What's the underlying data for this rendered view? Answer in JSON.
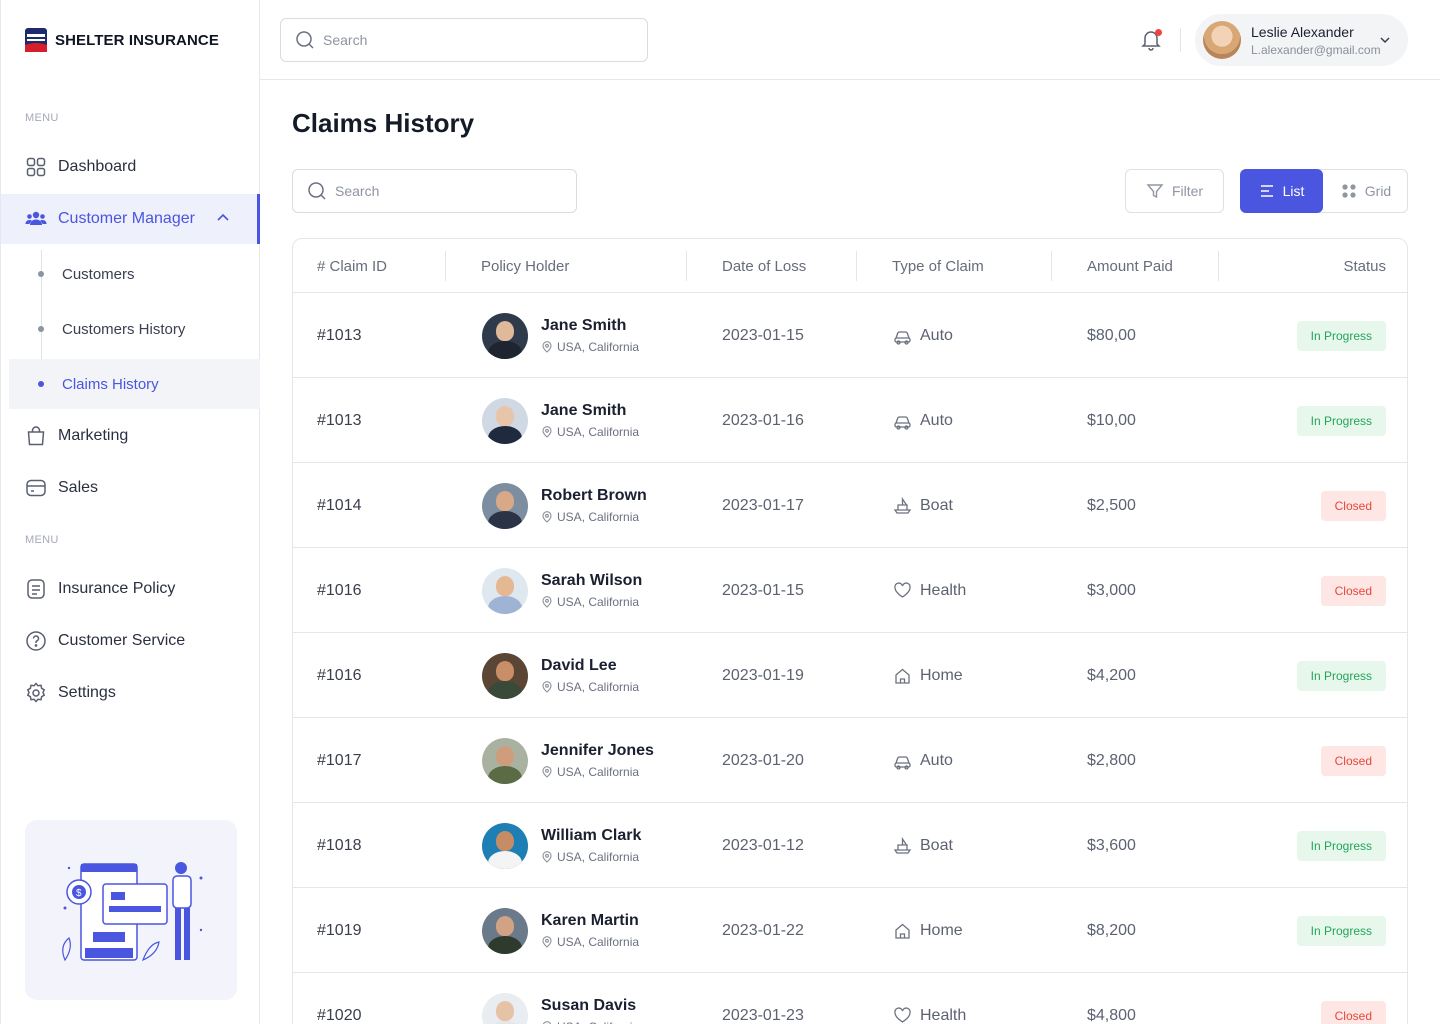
{
  "brand": {
    "name": "SHELTER INSURANCE"
  },
  "sidebar": {
    "menu_caption_1": "MENU",
    "menu_caption_2": "MENU",
    "items": [
      {
        "label": "Dashboard",
        "icon": "grid-icon"
      },
      {
        "label": "Customer Manager",
        "icon": "users-icon",
        "active": true,
        "expanded": true
      },
      {
        "label": "Marketing",
        "icon": "bag-icon"
      },
      {
        "label": "Sales",
        "icon": "card-icon"
      }
    ],
    "sub_items": [
      {
        "label": "Customers"
      },
      {
        "label": "Customers History"
      },
      {
        "label": "Claims History",
        "active": true
      }
    ],
    "items_2": [
      {
        "label": "Insurance Policy",
        "icon": "document-icon"
      },
      {
        "label": "Customer Service",
        "icon": "help-icon"
      },
      {
        "label": "Settings",
        "icon": "gear-icon"
      }
    ]
  },
  "topbar": {
    "search_placeholder": "Search",
    "user": {
      "name": "Leslie Alexander",
      "email": "L.alexander@gmail.com"
    }
  },
  "main": {
    "title": "Claims History",
    "search_placeholder": "Search",
    "filter_label": "Filter",
    "list_label": "List",
    "grid_label": "Grid"
  },
  "colors": {
    "accent": "#4a55e0",
    "in_progress_bg": "#e8f7ec",
    "in_progress_text": "#22a559",
    "closed_bg": "#fde6e4",
    "closed_text": "#e5483c"
  },
  "table": {
    "columns": [
      "# Claim ID",
      "Policy Holder",
      "Date of Loss",
      "Type of Claim",
      "Amount Paid",
      "Status"
    ],
    "rows": [
      {
        "id": "#1013",
        "name": "Jane Smith",
        "location": "USA, California",
        "date": "2023-01-15",
        "type": "Auto",
        "type_icon": "car-icon",
        "amount": "$80,00",
        "status": "In Progress",
        "status_kind": "progress"
      },
      {
        "id": "#1013",
        "name": "Jane Smith",
        "location": "USA, California",
        "date": "2023-01-16",
        "type": "Auto",
        "type_icon": "car-icon",
        "amount": "$10,00",
        "status": "In Progress",
        "status_kind": "progress"
      },
      {
        "id": "#1014",
        "name": "Robert Brown",
        "location": "USA, California",
        "date": "2023-01-17",
        "type": "Boat",
        "type_icon": "boat-icon",
        "amount": "$2,500",
        "status": "Closed",
        "status_kind": "closed"
      },
      {
        "id": "#1016",
        "name": "Sarah Wilson",
        "location": "USA, California",
        "date": "2023-01-15",
        "type": "Health",
        "type_icon": "heart-icon",
        "amount": "$3,000",
        "status": "Closed",
        "status_kind": "closed"
      },
      {
        "id": "#1016",
        "name": "David Lee",
        "location": "USA, California",
        "date": "2023-01-19",
        "type": "Home",
        "type_icon": "home-icon",
        "amount": "$4,200",
        "status": "In Progress",
        "status_kind": "progress"
      },
      {
        "id": "#1017",
        "name": "Jennifer Jones",
        "location": "USA, California",
        "date": "2023-01-20",
        "type": "Auto",
        "type_icon": "car-icon",
        "amount": "$2,800",
        "status": "Closed",
        "status_kind": "closed"
      },
      {
        "id": "#1018",
        "name": "William Clark",
        "location": "USA, California",
        "date": "2023-01-12",
        "type": "Boat",
        "type_icon": "boat-icon",
        "amount": "$3,600",
        "status": "In Progress",
        "status_kind": "progress"
      },
      {
        "id": "#1019",
        "name": "Karen Martin",
        "location": "USA, California",
        "date": "2023-01-22",
        "type": "Home",
        "type_icon": "home-icon",
        "amount": "$8,200",
        "status": "In Progress",
        "status_kind": "progress"
      },
      {
        "id": "#1020",
        "name": "Susan Davis",
        "location": "USA, California",
        "date": "2023-01-23",
        "type": "Health",
        "type_icon": "heart-icon",
        "amount": "$4,800",
        "status": "Closed",
        "status_kind": "closed"
      }
    ]
  }
}
